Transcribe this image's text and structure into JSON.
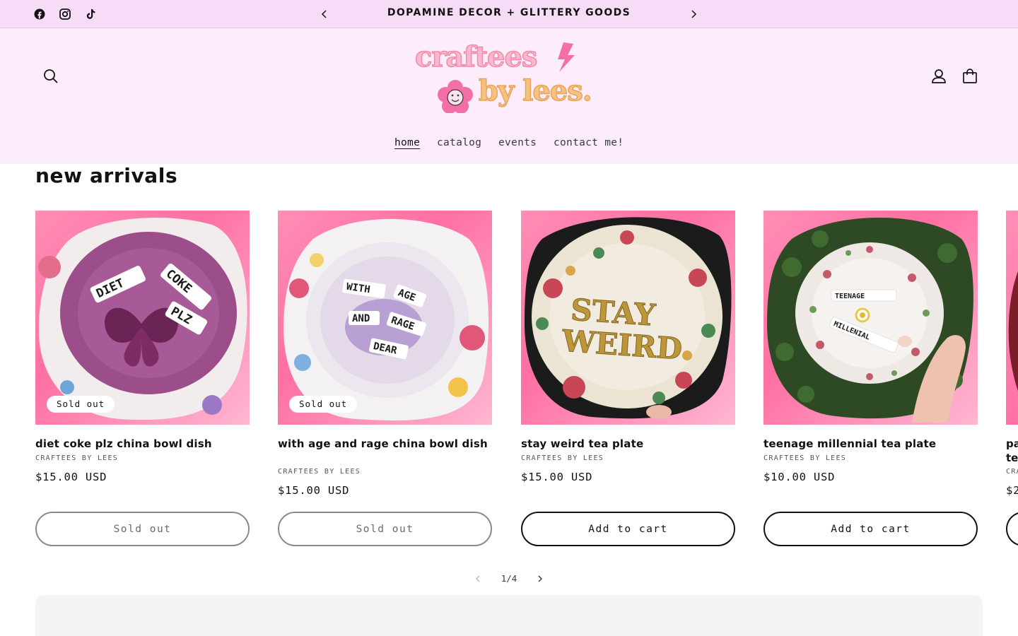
{
  "announcement": {
    "text": "DOPAMINE DECOR + GLITTERY GOODS",
    "social": [
      "facebook-icon",
      "instagram-icon",
      "tiktok-icon"
    ]
  },
  "header": {
    "logo_text_line1": "craftees",
    "logo_text_line2": "by lees.",
    "nav": [
      {
        "label": "home",
        "active": true
      },
      {
        "label": "catalog",
        "active": false
      },
      {
        "label": "events",
        "active": false
      },
      {
        "label": "contact me!",
        "active": false
      }
    ]
  },
  "section": {
    "title": "new arrivals"
  },
  "products": [
    {
      "title": "diet coke plz china bowl dish",
      "vendor": "CRAFTEES BY LEES",
      "price": "$15.00 USD",
      "badge": "Sold out",
      "button": "Sold out",
      "sold_out": true
    },
    {
      "title": "with age and rage china bowl dish",
      "vendor": "CRAFTEES BY LEES",
      "price": "$15.00 USD",
      "badge": "Sold out",
      "button": "Sold out",
      "sold_out": true
    },
    {
      "title": "stay weird tea plate",
      "vendor": "CRAFTEES BY LEES",
      "price": "$15.00 USD",
      "badge": "",
      "button": "Add to cart",
      "sold_out": false
    },
    {
      "title": "teenage millennial tea plate",
      "vendor": "CRAFTEES BY LEES",
      "price": "$10.00 USD",
      "badge": "",
      "button": "Add to cart",
      "sold_out": false
    }
  ],
  "peek_product": {
    "title_line1": "pa",
    "title_line2": "te",
    "vendor": "CRA",
    "price": "$2"
  },
  "plate_texts": {
    "p1_a": "DIET",
    "p1_b": "COKE",
    "p1_c": "PLZ",
    "p2_a": "WITH",
    "p2_b": "AGE",
    "p2_c": "AND",
    "p2_d": "RAGE",
    "p2_e": "DEAR",
    "p3_a": "STAY",
    "p3_b": "WEIRD",
    "p4_a": "TEENAGE",
    "p4_b": "MILLENIAL"
  },
  "pagination": {
    "text": "1/4"
  },
  "colors": {
    "announcement_bg": "#f6dcf6",
    "header_bg": "#fcecfc",
    "card_gradient": "#ff6fa3",
    "button_border": "#121212"
  }
}
